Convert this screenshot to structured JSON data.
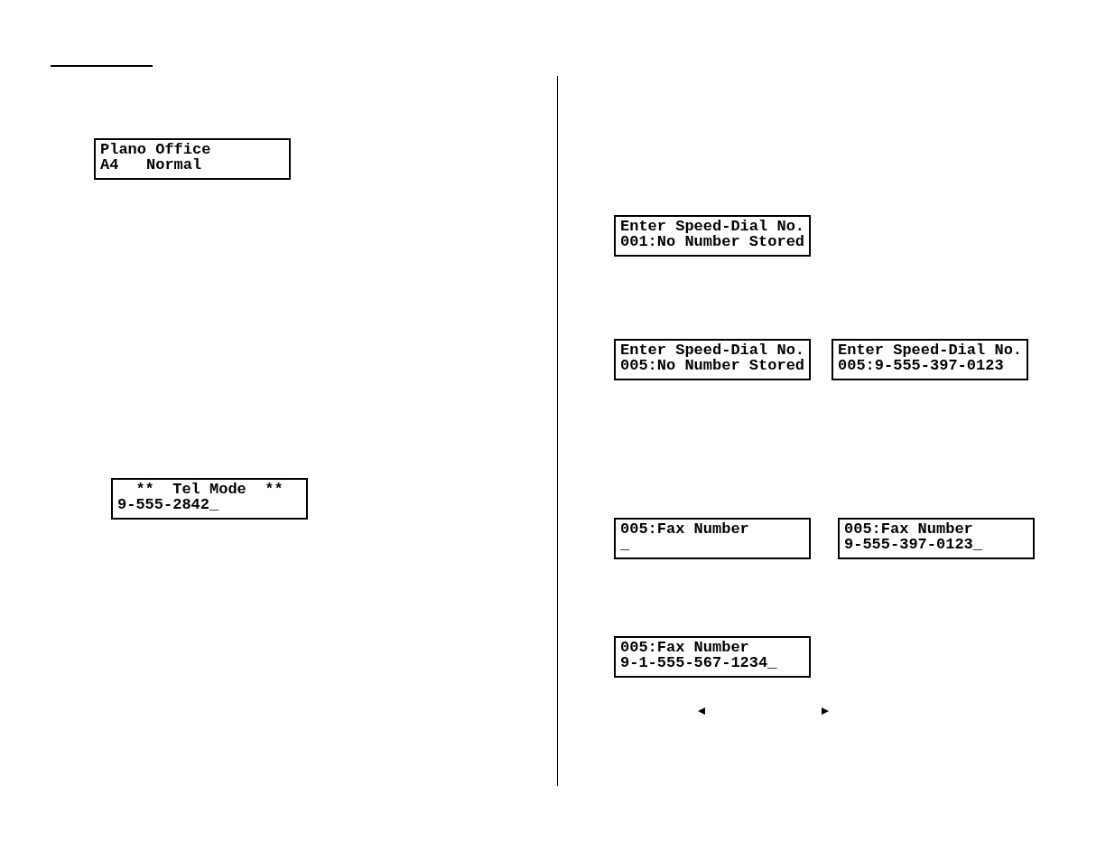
{
  "left_column": {
    "displays": [
      {
        "lines": [
          "Plano Office",
          "A4   Normal"
        ]
      },
      {
        "lines": [
          "  **  Tel Mode  **",
          "9-555-2842_"
        ]
      }
    ]
  },
  "right_column": {
    "display_rows": [
      {
        "displays": [
          {
            "lines": [
              "Enter Speed-Dial No.",
              "001:No Number Stored"
            ]
          }
        ]
      },
      {
        "displays": [
          {
            "lines": [
              "Enter Speed-Dial No.",
              "005:No Number Stored"
            ]
          },
          {
            "lines": [
              "Enter Speed-Dial No.",
              "005:9-555-397-0123"
            ]
          }
        ]
      },
      {
        "displays": [
          {
            "lines": [
              "005:Fax Number",
              "_"
            ]
          },
          {
            "lines": [
              "005:Fax Number",
              "9-555-397-0123_"
            ]
          }
        ]
      },
      {
        "displays": [
          {
            "lines": [
              "005:Fax Number",
              "9-1-555-567-1234_"
            ]
          }
        ]
      }
    ]
  }
}
